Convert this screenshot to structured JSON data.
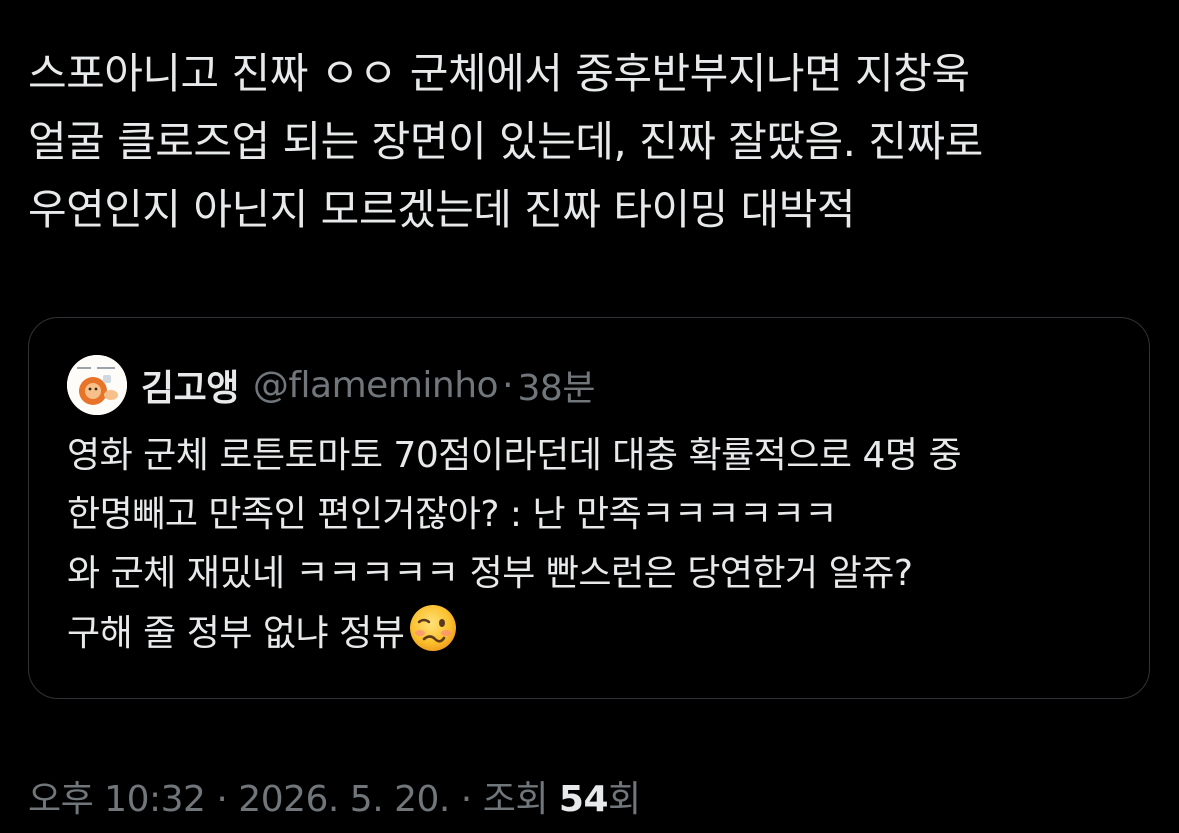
{
  "tweet": {
    "lines": [
      "스포아니고 진짜 ㅇㅇ 군체에서 중후반부지나면 지창욱",
      "얼굴 클로즈업 되는 장면이 있는데, 진짜 잘땄음. 진짜로",
      "우연인지 아닌지 모르겠는데 진짜 타이밍 대박적"
    ]
  },
  "quote": {
    "display_name": "김고앵",
    "handle": "@flameminho",
    "separator": "·",
    "time_ago": "38분",
    "avatar_icon": "lion-cartoon-avatar",
    "lines": [
      "영화 군체 로튼토마토 70점이라던데 대충 확률적으로 4명 중",
      "한명빼고 만족인 편인거잖아? : 난 만족ㅋㅋㅋㅋㅋㅋ",
      "와 군체 재밌네 ㅋㅋㅋㅋㅋ 정부 빤스런은 당연한거 알쥬?",
      "구해 줄 정부 없냐 정뷰"
    ],
    "emoji_icon": "woozy-face-emoji"
  },
  "meta": {
    "time": "오후 10:32",
    "sep1": "·",
    "date": "2026. 5. 20.",
    "sep2": "·",
    "views_label": "조회",
    "views_count": "54",
    "views_suffix": "회"
  },
  "colors": {
    "background": "#000000",
    "text_primary": "#e7e9ea",
    "text_secondary": "#71767b",
    "border": "#2f3336"
  }
}
